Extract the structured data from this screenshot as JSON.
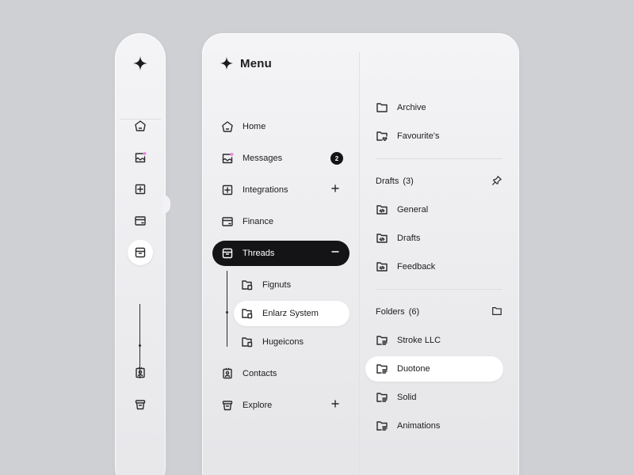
{
  "menu": {
    "title": "Menu"
  },
  "nav": {
    "items": [
      {
        "label": "Home",
        "icon": "home-icon"
      },
      {
        "label": "Messages",
        "icon": "inbox-icon",
        "badge": "2"
      },
      {
        "label": "Integrations",
        "icon": "plus-square-icon",
        "trail": "plus-icon"
      },
      {
        "label": "Finance",
        "icon": "card-icon"
      },
      {
        "label": "Threads",
        "icon": "package-icon",
        "trail": "minus-icon",
        "active": true
      },
      {
        "label": "Contacts",
        "icon": "contact-card-icon"
      },
      {
        "label": "Explore",
        "icon": "stack-icon",
        "trail": "plus-icon"
      }
    ],
    "threads_children": [
      {
        "label": "Fignuts",
        "icon": "folder-file-icon"
      },
      {
        "label": "Enlarz System",
        "icon": "folder-file-icon",
        "selected": true
      },
      {
        "label": "Hugeicons",
        "icon": "folder-file-icon"
      }
    ]
  },
  "right": {
    "top_items": [
      {
        "label": "Archive",
        "icon": "folder-icon"
      },
      {
        "label": "Favourite's",
        "icon": "folder-heart-icon"
      }
    ],
    "drafts": {
      "title": "Drafts",
      "count": "(3)",
      "items": [
        {
          "label": "General",
          "icon": "folder-code-icon"
        },
        {
          "label": "Drafts",
          "icon": "folder-code-icon"
        },
        {
          "label": "Feedback",
          "icon": "folder-code-icon"
        }
      ]
    },
    "folders": {
      "title": "Folders",
      "count": "(6)",
      "items": [
        {
          "label": "Stroke LLC",
          "icon": "folder-lines-icon"
        },
        {
          "label": "Duotone",
          "icon": "folder-lines-icon",
          "selected": true
        },
        {
          "label": "Solid",
          "icon": "folder-lines-icon"
        },
        {
          "label": "Animations",
          "icon": "folder-lines-icon"
        }
      ]
    }
  },
  "colors": {
    "background": "#cfd0d4",
    "active_item": "#141416",
    "notification_dot": "#e98be0"
  }
}
